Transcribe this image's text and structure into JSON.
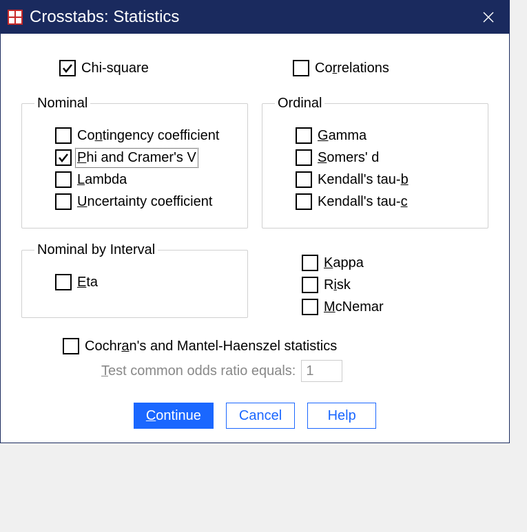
{
  "titlebar": {
    "title": "Crosstabs: Statistics"
  },
  "top": {
    "chi_square": {
      "label": "Chi-square",
      "checked": true
    },
    "correlations": {
      "label": "Correlations",
      "checked": false
    }
  },
  "nominal": {
    "legend": "Nominal",
    "items": [
      {
        "label_pre": "Co",
        "label_u": "n",
        "label_post": "tingency coefficient",
        "checked": false
      },
      {
        "label_pre": "",
        "label_u": "P",
        "label_post": "hi and Cramer's V",
        "checked": true,
        "focused": true
      },
      {
        "label_pre": "",
        "label_u": "L",
        "label_post": "ambda",
        "checked": false
      },
      {
        "label_pre": "",
        "label_u": "U",
        "label_post": "ncertainty coefficient",
        "checked": false
      }
    ]
  },
  "ordinal": {
    "legend": "Ordinal",
    "items": [
      {
        "label_pre": "",
        "label_u": "G",
        "label_post": "amma",
        "checked": false
      },
      {
        "label_pre": "",
        "label_u": "S",
        "label_post": "omers' d",
        "checked": false
      },
      {
        "label_pre": "Kendall's tau-",
        "label_u": "b",
        "label_post": "",
        "checked": false
      },
      {
        "label_pre": "Kendall's tau-",
        "label_u": "c",
        "label_post": "",
        "checked": false
      }
    ]
  },
  "nominal_interval": {
    "legend": "Nominal by Interval",
    "items": [
      {
        "label_pre": "",
        "label_u": "E",
        "label_post": "ta",
        "checked": false
      }
    ]
  },
  "right_extra": {
    "items": [
      {
        "label_pre": "",
        "label_u": "K",
        "label_post": "appa",
        "checked": false
      },
      {
        "label_pre": "R",
        "label_u": "i",
        "label_post": "sk",
        "checked": false
      },
      {
        "label_pre": "",
        "label_u": "M",
        "label_post": "cNemar",
        "checked": false
      }
    ]
  },
  "cochran": {
    "label_pre": "Cochr",
    "label_u": "a",
    "label_post": "n's and Mantel-Haenszel statistics",
    "checked": false,
    "odds_label_pre": "",
    "odds_label_u": "T",
    "odds_label_post": "est common odds ratio equals:",
    "odds_value": "1"
  },
  "buttons": {
    "continue_pre": "",
    "continue_u": "C",
    "continue_post": "ontinue",
    "cancel": "Cancel",
    "help": "Help"
  }
}
